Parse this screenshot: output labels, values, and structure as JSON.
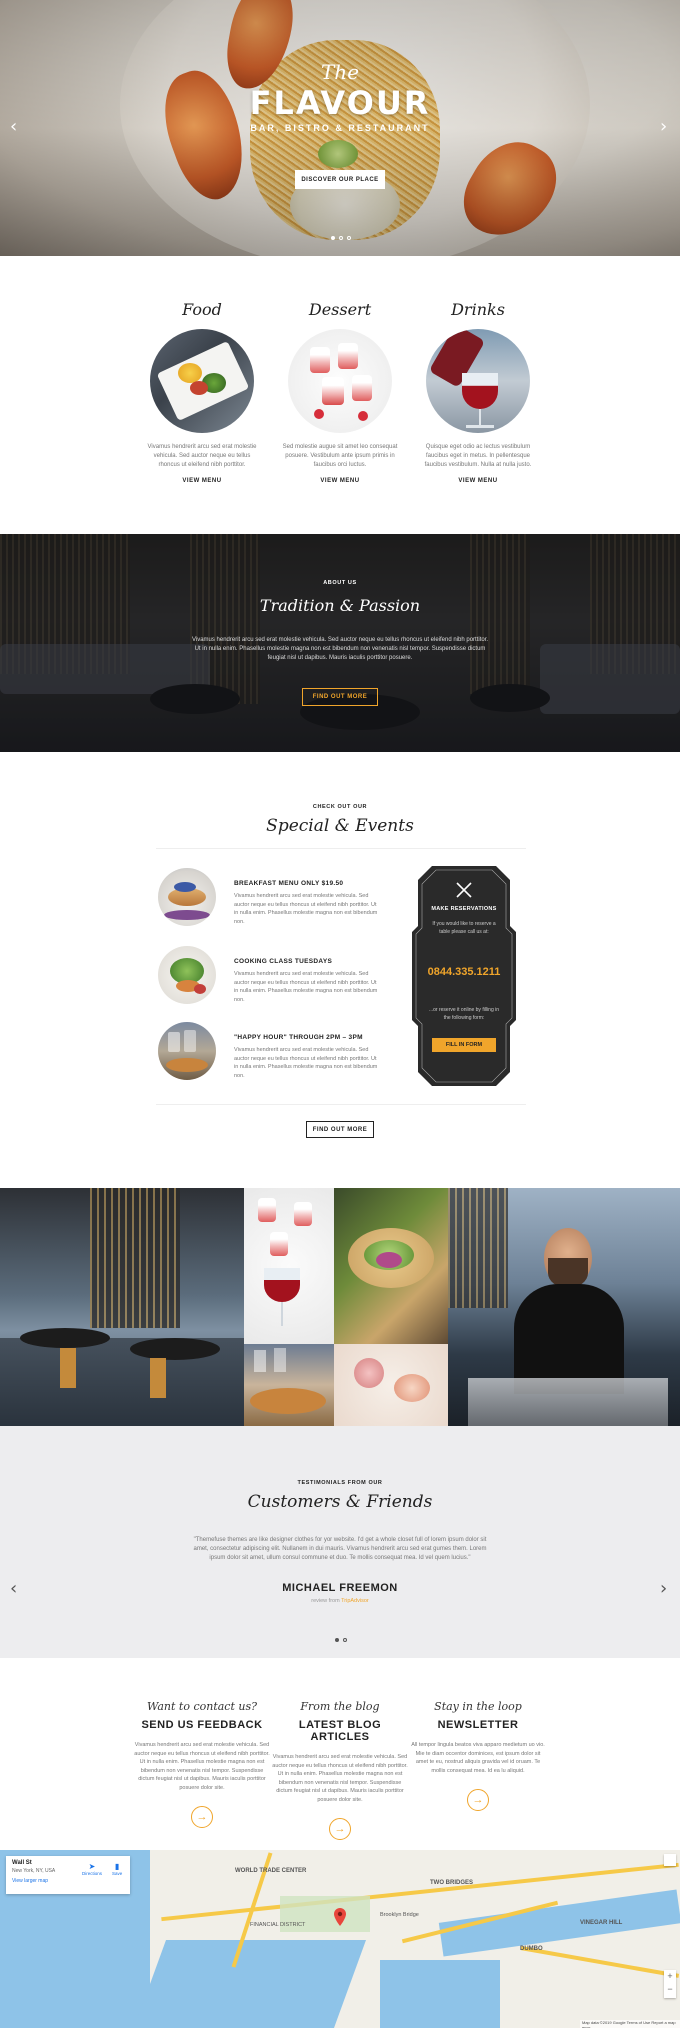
{
  "hero": {
    "script_title": "The",
    "title": "FLAVOUR",
    "subtitle": "BAR, BISTRO & RESTAURANT",
    "button": "DISCOVER OUR PLACE",
    "prev": "‹",
    "next": "›"
  },
  "menu": {
    "items": [
      {
        "title": "Food",
        "text": "Vivamus hendrerit arcu sed erat molestie vehicula. Sed auctor neque eu tellus rhoncus ut eleifend nibh porttitor.",
        "link": "VIEW MENU"
      },
      {
        "title": "Dessert",
        "text": "Sed molestie augue sit amet leo consequat posuere. Vestibulum ante ipsum primis in faucibus orci luctus.",
        "link": "VIEW MENU"
      },
      {
        "title": "Drinks",
        "text": "Quisque eget odio ac lectus vestibulum faucibus eget in metus. In pellentesque faucibus vestibulum. Nulla at nulla justo.",
        "link": "VIEW MENU"
      }
    ]
  },
  "about": {
    "kicker": "ABOUT US",
    "title": "Tradition & Passion",
    "text": "Vivamus hendrerit arcu sed erat molestie vehicula. Sed auctor neque eu tellus rhoncus ut eleifend nibh porttitor. Ut in nulla enim. Phasellus molestie magna non est bibendum non venenatis nisl tempor. Suspendisse dictum feugiat nisl ut dapibus. Mauris iaculis porttitor posuere.",
    "button": "FIND OUT MORE"
  },
  "specials": {
    "kicker": "CHECK OUT OUR",
    "title": "Special & Events",
    "events": [
      {
        "title": "BREAKFAST MENU ONLY $19.50",
        "text": "Vivamus hendrerit arcu sed erat molestie vehicula. Sed auctor neque eu tellus rhoncus ut eleifend nibh porttitor. Ut in nulla enim. Phasellus molestie magna non est bibendum non."
      },
      {
        "title": "COOKING CLASS TUESDAYS",
        "text": "Vivamus hendrerit arcu sed erat molestie vehicula. Sed auctor neque eu tellus rhoncus ut eleifend nibh porttitor. Ut in nulla enim. Phasellus molestie magna non est bibendum non."
      },
      {
        "title": "\"HAPPY HOUR\" THROUGH 2PM – 3PM",
        "text": "Vivamus hendrerit arcu sed erat molestie vehicula. Sed auctor neque eu tellus rhoncus ut eleifend nibh porttitor. Ut in nulla enim. Phasellus molestie magna non est bibendum non."
      }
    ],
    "reservation": {
      "heading": "MAKE RESERVATIONS",
      "text": "If you would like to reserve a table please call us at:",
      "phone": "0844.335.1211",
      "text2": "...or reserve it online by filling in the following form:",
      "button": "FILL IN FORM"
    },
    "button": "FIND OUT MORE"
  },
  "testimonials": {
    "kicker": "TESTIMONIALS FROM OUR",
    "title": "Customers & Friends",
    "quote": "\"Themefuse themes are like designer clothes for yor website. I'd get a whole closet full of lorem ipsum dolor sit amet, consectetur adipiscing elit. Nullanem in dui mauris. Vivamus hendrerit arcu sed erat gumes them. Lorem ipsum dolor sit amet, ullum consul commune et duo. Te mollis consequat mea. Id vel quem lucius.\"",
    "name": "MICHAEL FREEMON",
    "review_prefix": "review from",
    "review_source": "TripAdvisor",
    "prev": "‹",
    "next": "›"
  },
  "contact": {
    "columns": [
      {
        "kicker": "Want to contact us?",
        "title": "SEND US FEEDBACK",
        "text": "Vivamus hendrerit arcu sed erat molestie vehicula. Sed auctor neque eu tellus rhoncus ut eleifend nibh porttitor. Ut in nulla enim. Phasellus molestie magna non est bibendum non venenatis nisl tempor. Suspendisse dictum feugiat nisl ut dapibus. Mauris iaculis porttitor posuere dolor site."
      },
      {
        "kicker": "From the blog",
        "title": "LATEST BLOG ARTICLES",
        "text": "Vivamus hendrerit arcu sed erat molestie vehicula. Sed auctor neque eu tellus rhoncus ut eleifend nibh porttitor. Ut in nulla enim. Phasellus molestie magna non est bibendum non venenatis nisl tempor. Suspendisse dictum feugiat nisl ut dapibus. Mauris iaculis porttitor posuere dolor site."
      },
      {
        "kicker": "Stay in the loop",
        "title": "NEWSLETTER",
        "text": "All tempor lingula beatos viva apparo medietum uo vio. Mie te diam occentor dominices, est ipsum dolor sit amet te eu, nostrud aliquis gravida vel id oruam. Te mollis consequat mea. Id ea lu aliquid."
      }
    ],
    "arrow": "→"
  },
  "map": {
    "place": "Wall St",
    "address": "New York, NY, USA",
    "directions": "Directions",
    "save": "Save",
    "larger": "View larger map",
    "labels": [
      "WORLD TRADE CENTER",
      "TWO BRIDGES",
      "DUMBO",
      "VINEGAR HILL",
      "Brooklyn Bridge",
      "FINANCIAL DISTRICT"
    ],
    "credit": "Map data ©2019 Google   Terms of Use   Report a map error"
  },
  "colors": {
    "accent": "#f0a52b",
    "dark": "#222222",
    "light_bg": "#ededef"
  }
}
